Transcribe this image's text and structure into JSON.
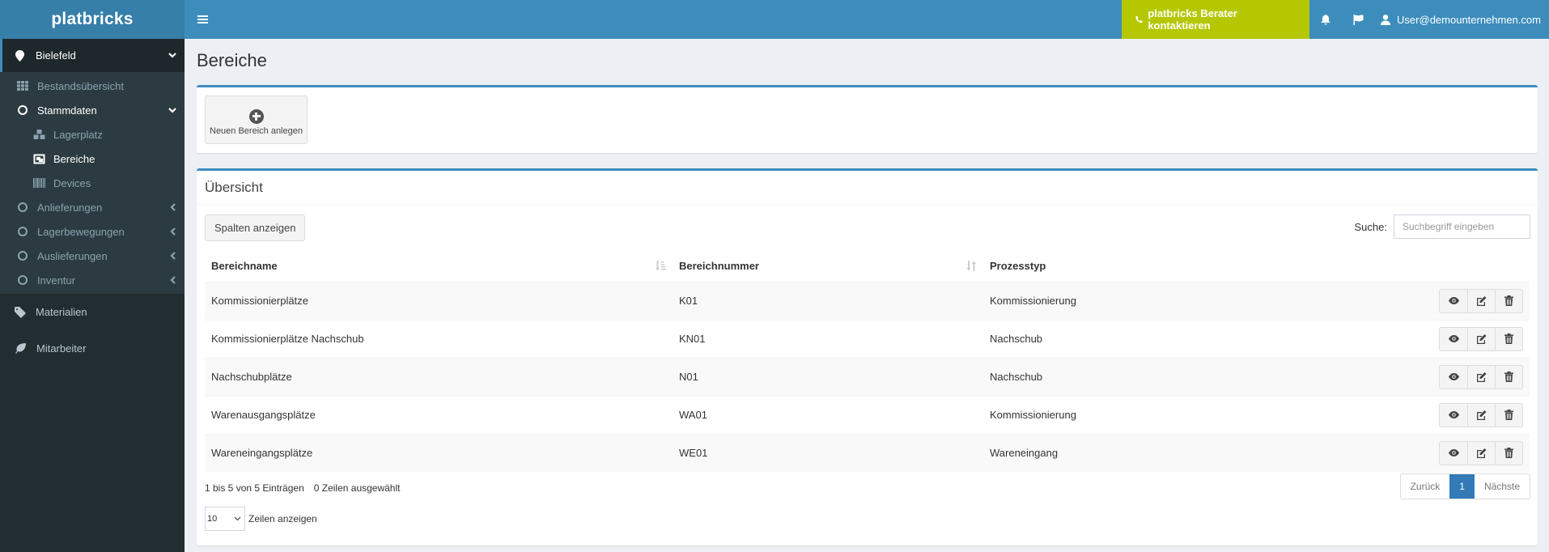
{
  "header": {
    "logo": "platbricks",
    "contact_label": "platbricks Berater kontaktieren",
    "user_email": "User@demounternehmen.com",
    "contact_color": "#b5c700",
    "brand_color": "#3c8dbc"
  },
  "sidebar": {
    "location": "Bielefeld",
    "items": [
      {
        "label": "Bestandsübersicht",
        "icon": "grid-icon"
      },
      {
        "label": "Stammdaten",
        "icon": "circle-icon",
        "expanded": true,
        "children": [
          {
            "label": "Lagerplatz",
            "icon": "cubes-icon"
          },
          {
            "label": "Bereiche",
            "icon": "object-group-icon",
            "active": true
          },
          {
            "label": "Devices",
            "icon": "barcode-icon"
          }
        ]
      },
      {
        "label": "Anlieferungen",
        "icon": "circle-icon"
      },
      {
        "label": "Lagerbewegungen",
        "icon": "circle-icon"
      },
      {
        "label": "Auslieferungen",
        "icon": "circle-icon"
      },
      {
        "label": "Inventur",
        "icon": "circle-icon"
      }
    ],
    "main_items": [
      {
        "label": "Materialien",
        "icon": "tag-icon"
      },
      {
        "label": "Mitarbeiter",
        "icon": "leaf-icon"
      }
    ]
  },
  "page": {
    "title": "Bereiche",
    "new_button": "Neuen Bereich anlegen",
    "overview_title": "Übersicht",
    "columns_button": "Spalten anzeigen",
    "search_label": "Suche:",
    "search_placeholder": "Suchbegriff eingeben",
    "search_value": ""
  },
  "table": {
    "headers": [
      "Bereichname",
      "Bereichnummer",
      "Prozesstyp"
    ],
    "rows": [
      {
        "name": "Kommissionierplätze",
        "number": "K01",
        "type": "Kommissionierung"
      },
      {
        "name": "Kommissionierplätze Nachschub",
        "number": "KN01",
        "type": "Nachschub"
      },
      {
        "name": "Nachschubplätze",
        "number": "N01",
        "type": "Nachschub"
      },
      {
        "name": "Warenausgangsplätze",
        "number": "WA01",
        "type": "Kommissionierung"
      },
      {
        "name": "Wareneingangsplätze",
        "number": "WE01",
        "type": "Wareneingang"
      }
    ]
  },
  "footer": {
    "info": "1 bis 5 von 5 Einträgen",
    "selected": "0 Zeilen ausgewählt",
    "prev": "Zurück",
    "page": "1",
    "next": "Nächste",
    "page_length": "10",
    "page_length_label": "Zeilen anzeigen"
  }
}
